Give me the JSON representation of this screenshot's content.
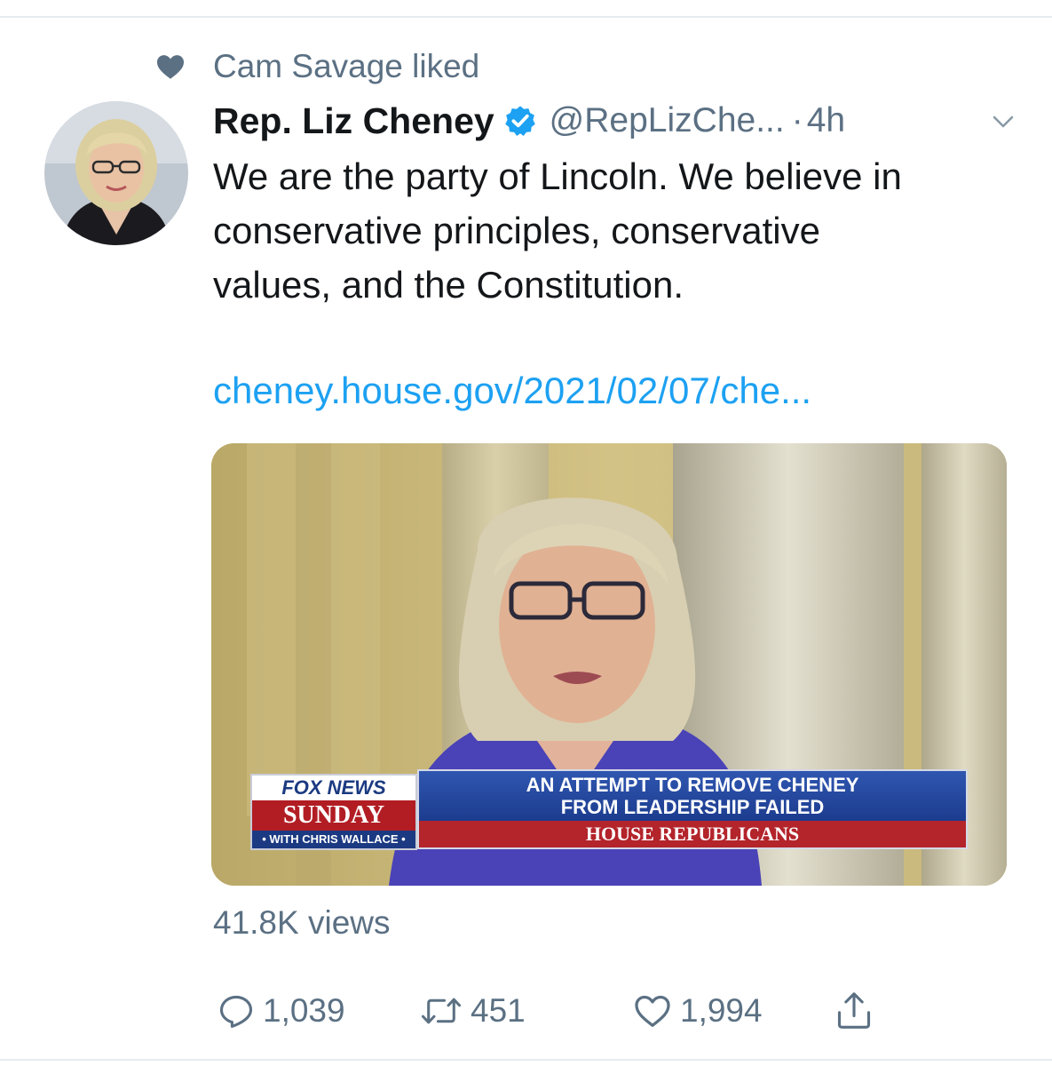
{
  "social_context": {
    "text": "Cam Savage liked",
    "icon": "heart-filled-icon"
  },
  "tweet": {
    "display_name": "Rep. Liz Cheney",
    "verified": true,
    "handle": "@RepLizChe...",
    "separator": "·",
    "timestamp": "4h",
    "text_lines": [
      "We are the party of Lincoln. We believe in",
      "conservative principles, conservative",
      "values, and the Constitution."
    ],
    "link": "cheney.house.gov/2021/02/07/che..."
  },
  "media": {
    "type": "video",
    "brand": {
      "network": "FOX NEWS",
      "show": "SUNDAY",
      "host_line": "• WITH CHRIS WALLACE •"
    },
    "headline_lines": [
      "AN ATTEMPT TO REMOVE CHENEY",
      "FROM LEADERSHIP FAILED"
    ],
    "subline": "HOUSE REPUBLICANS"
  },
  "views": "41.8K views",
  "actions": {
    "reply": {
      "icon": "reply-icon",
      "count": "1,039"
    },
    "retweet": {
      "icon": "retweet-icon",
      "count": "451"
    },
    "like": {
      "icon": "heart-outline-icon",
      "count": "1,994"
    },
    "share": {
      "icon": "share-icon"
    }
  },
  "colors": {
    "link": "#1da1f2",
    "secondary_text": "#5b7083",
    "primary_text": "#14171a",
    "verified": "#1da1f2"
  }
}
